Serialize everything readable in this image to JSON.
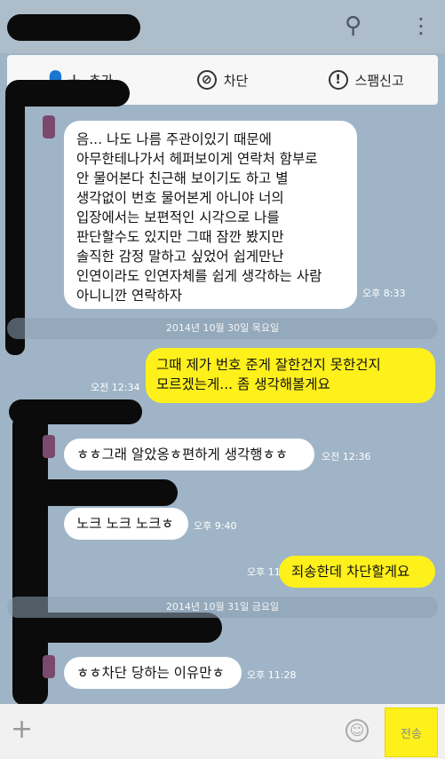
{
  "actions": {
    "add": "추가",
    "block": "차단",
    "report": "스팸신고"
  },
  "messages": [
    {
      "text": "음...  나도 나름 주관이있기 때문에\n아무한테나가서 헤퍼보이게 연락처 함부로\n안 물어본다  친근해 보이기도 하고 별\n생각없이 번호 물어본게 아니야  너의\n입장에서는 보편적인 시각으로 나를\n판단할수도 있지만 그때 잠깐 봤지만\n솔직한 감정 말하고 싶었어  쉽게만난\n인연이라도 인연자체를 쉽게 생각하는 사람\n아니니깐 연락하자",
      "time": "오후 8:33"
    },
    {
      "text": "그때 제가 번호 준게 잘한건지 못한건지\n모르겠는게... 좀 생각해볼게요",
      "time": "오전 12:34"
    },
    {
      "text": "ㅎㅎ그래 알았옹ㅎ편하게 생각행ㅎㅎ",
      "time": "오전 12:36"
    },
    {
      "text": "노크 노크 노크ㅎ",
      "time": "오후 9:40"
    },
    {
      "text": "죄송한데 차단할게요",
      "time": "오후 11:34"
    },
    {
      "text": "ㅎㅎ차단 당하는 이유만ㅎ",
      "time": "오후 11:28"
    }
  ],
  "dates": [
    "2014년 10월 30일 목요일",
    "2014년 10월 31일 금요일"
  ],
  "input": {
    "send_label": "전송"
  },
  "icons": {
    "search": "search-icon",
    "menu": "more-vertical-icon",
    "emoji": "emoji-icon",
    "attach": "plus-icon"
  },
  "colors": {
    "background": "#9fb4c6",
    "my_bubble": "#fef01b",
    "their_bubble": "#ffffff"
  }
}
